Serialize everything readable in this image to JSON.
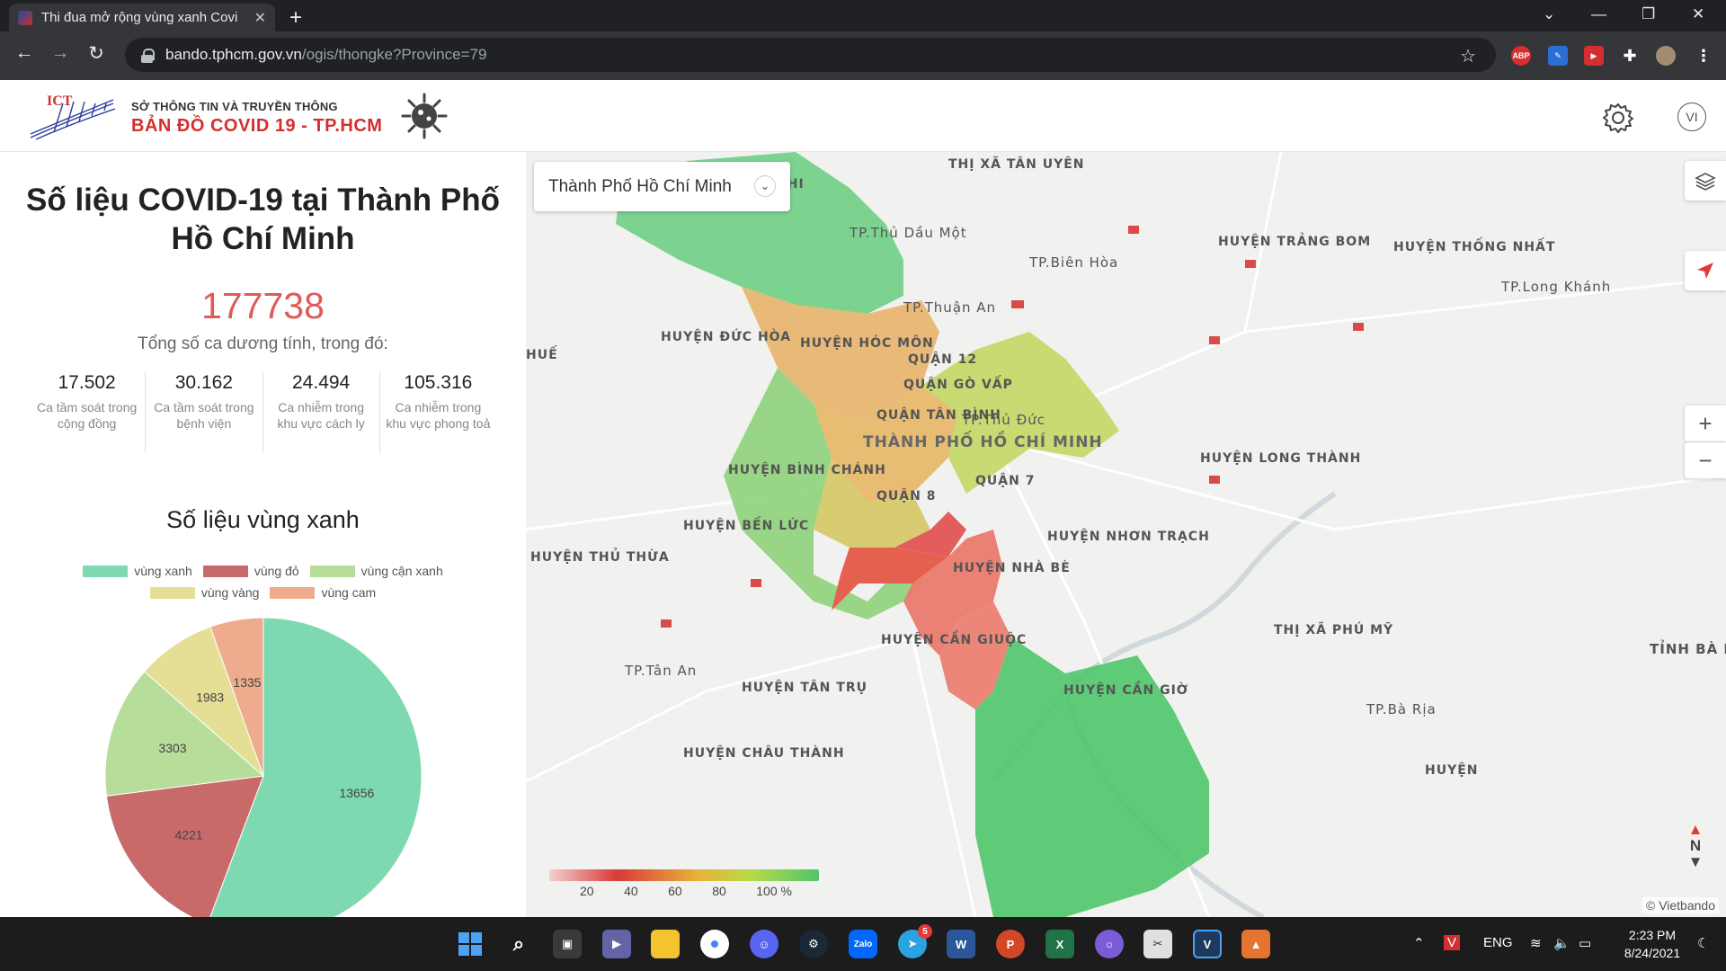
{
  "browser": {
    "tab_title": "Thi đua mở rộng vùng xanh Covi",
    "url_host": "bando.tphcm.gov.vn",
    "url_path": "/ogis/thongke?Province=79",
    "extensions": [
      "ABP",
      "pen-icon",
      "video-icon",
      "puzzle-icon",
      "profile-avatar"
    ]
  },
  "header": {
    "org_logo_text": "ICT",
    "org_name": "SỞ THÔNG TIN VÀ TRUYỀN THÔNG",
    "app_name": "BẢN ĐỒ  COVID 19 - TP.HCM",
    "language": "VI"
  },
  "panel": {
    "title": "Số liệu COVID-19 tại Thành Phố Hồ Chí Minh",
    "total": "177738",
    "total_label": "Tổng số ca dương tính, trong đó:",
    "stats": [
      {
        "value": "17.502",
        "label": "Ca tầm soát trong cộng đồng"
      },
      {
        "value": "30.162",
        "label": "Ca tầm soát trong bệnh viện"
      },
      {
        "value": "24.494",
        "label": "Ca nhiễm trong khu vực cách ly"
      },
      {
        "value": "105.316",
        "label": "Ca nhiễm trong khu vực phong toả"
      }
    ],
    "subtitle": "Số liệu vùng xanh"
  },
  "chart_data": {
    "type": "pie",
    "title": "Số liệu vùng xanh",
    "legend_position": "top",
    "categories": [
      "vùng xanh",
      "vùng đỏ",
      "vùng cận xanh",
      "vùng vàng",
      "vùng cam"
    ],
    "values": [
      13656,
      4221,
      3303,
      1983,
      1335
    ],
    "colors": [
      "#7fd9b0",
      "#c96a6a",
      "#b7dd9b",
      "#e5df96",
      "#eeab8d"
    ]
  },
  "map": {
    "selected_area": "Thành Phố Hồ Chí Minh",
    "zoom_in": "+",
    "zoom_out": "−",
    "scale_ticks": [
      "20",
      "40",
      "60",
      "80",
      "100 %"
    ],
    "attribution": "© Vietbando",
    "north": "N",
    "labels": [
      "CỦ CHI",
      "THỊ XÃ TÂN UYÊN",
      "TP.Thủ Dầu Một",
      "TP.Biên Hòa",
      "HUYỆN TRẢNG BOM",
      "HUYỆN THỐNG NHẤT",
      "TP.Long Khánh",
      "TP.Thuận An",
      "HUYỆN ĐỨC HÒA",
      "HUYỆN HÓC MÔN",
      "QUẬN 12",
      "QUẬN GÒ VẤP",
      "QUẬN TÂN BÌNH",
      "TP.Thủ Đức",
      "THÀNH PHỐ HỒ CHÍ MINH",
      "HUYỆN BÌNH CHÁNH",
      "QUẬN 7",
      "QUẬN 8",
      "HUYỆN LONG THÀNH",
      "HUYỆN BẾN LỨC",
      "HUYỆN NHƠN TRẠCH",
      "HUYỆN THỦ THỪA",
      "HUYỆN NHÀ BÈ",
      "HUYỆN CẦN GIUỘC",
      "THỊ XÃ PHÚ MỸ",
      "TP.Tân An",
      "HUYỆN TÂN TRỤ",
      "HUYỆN CẦN GIỜ",
      "TP.Bà Rịa",
      "HUYỆN CHÂU THÀNH",
      "HUẾ",
      "TỈNH BÀ RỊA VŨNG TÀU",
      "HUYỆN"
    ]
  },
  "taskbar": {
    "badge_count": "5",
    "lang": "ENG",
    "time": "2:23 PM",
    "date": "8/24/2021"
  }
}
